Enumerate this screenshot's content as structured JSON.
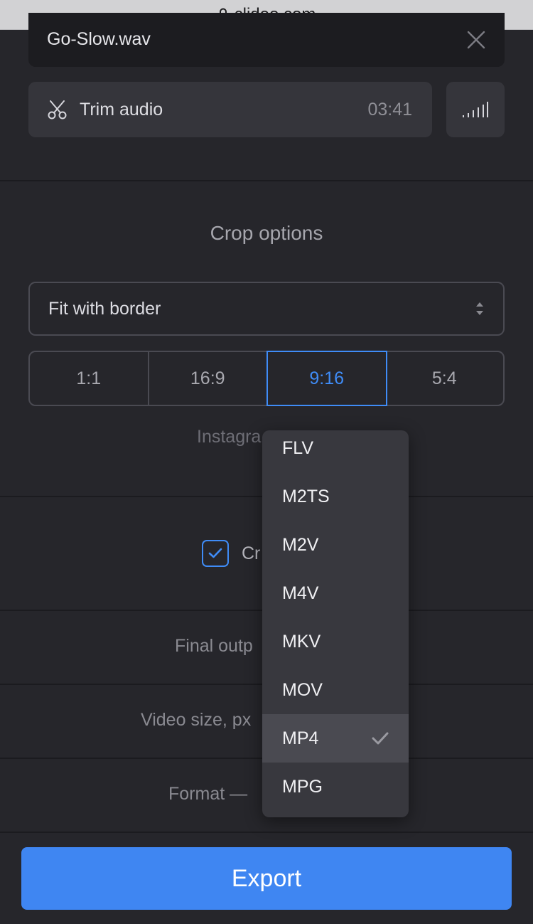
{
  "browser": {
    "url": "clideo.com"
  },
  "file": {
    "name": "Go-Slow.wav"
  },
  "trim": {
    "label": "Trim audio",
    "duration": "03:41"
  },
  "crop": {
    "title": "Crop options",
    "mode": "Fit with border",
    "ratios": [
      "1:1",
      "16:9",
      "9:16",
      "5:4"
    ],
    "active_ratio": "9:16",
    "platform_hint": "Instagra"
  },
  "checkbox": {
    "label": "Cr",
    "checked": true
  },
  "rows": {
    "final_output": "Final outp",
    "video_size": "Video size, px",
    "format": "Format —"
  },
  "format_dropdown": {
    "items": [
      "FLV",
      "M2TS",
      "M2V",
      "M4V",
      "MKV",
      "MOV",
      "MP4",
      "MPG"
    ],
    "selected": "MP4"
  },
  "export": {
    "label": "Export"
  },
  "colors": {
    "accent": "#3f86f2",
    "background": "#26262b"
  }
}
